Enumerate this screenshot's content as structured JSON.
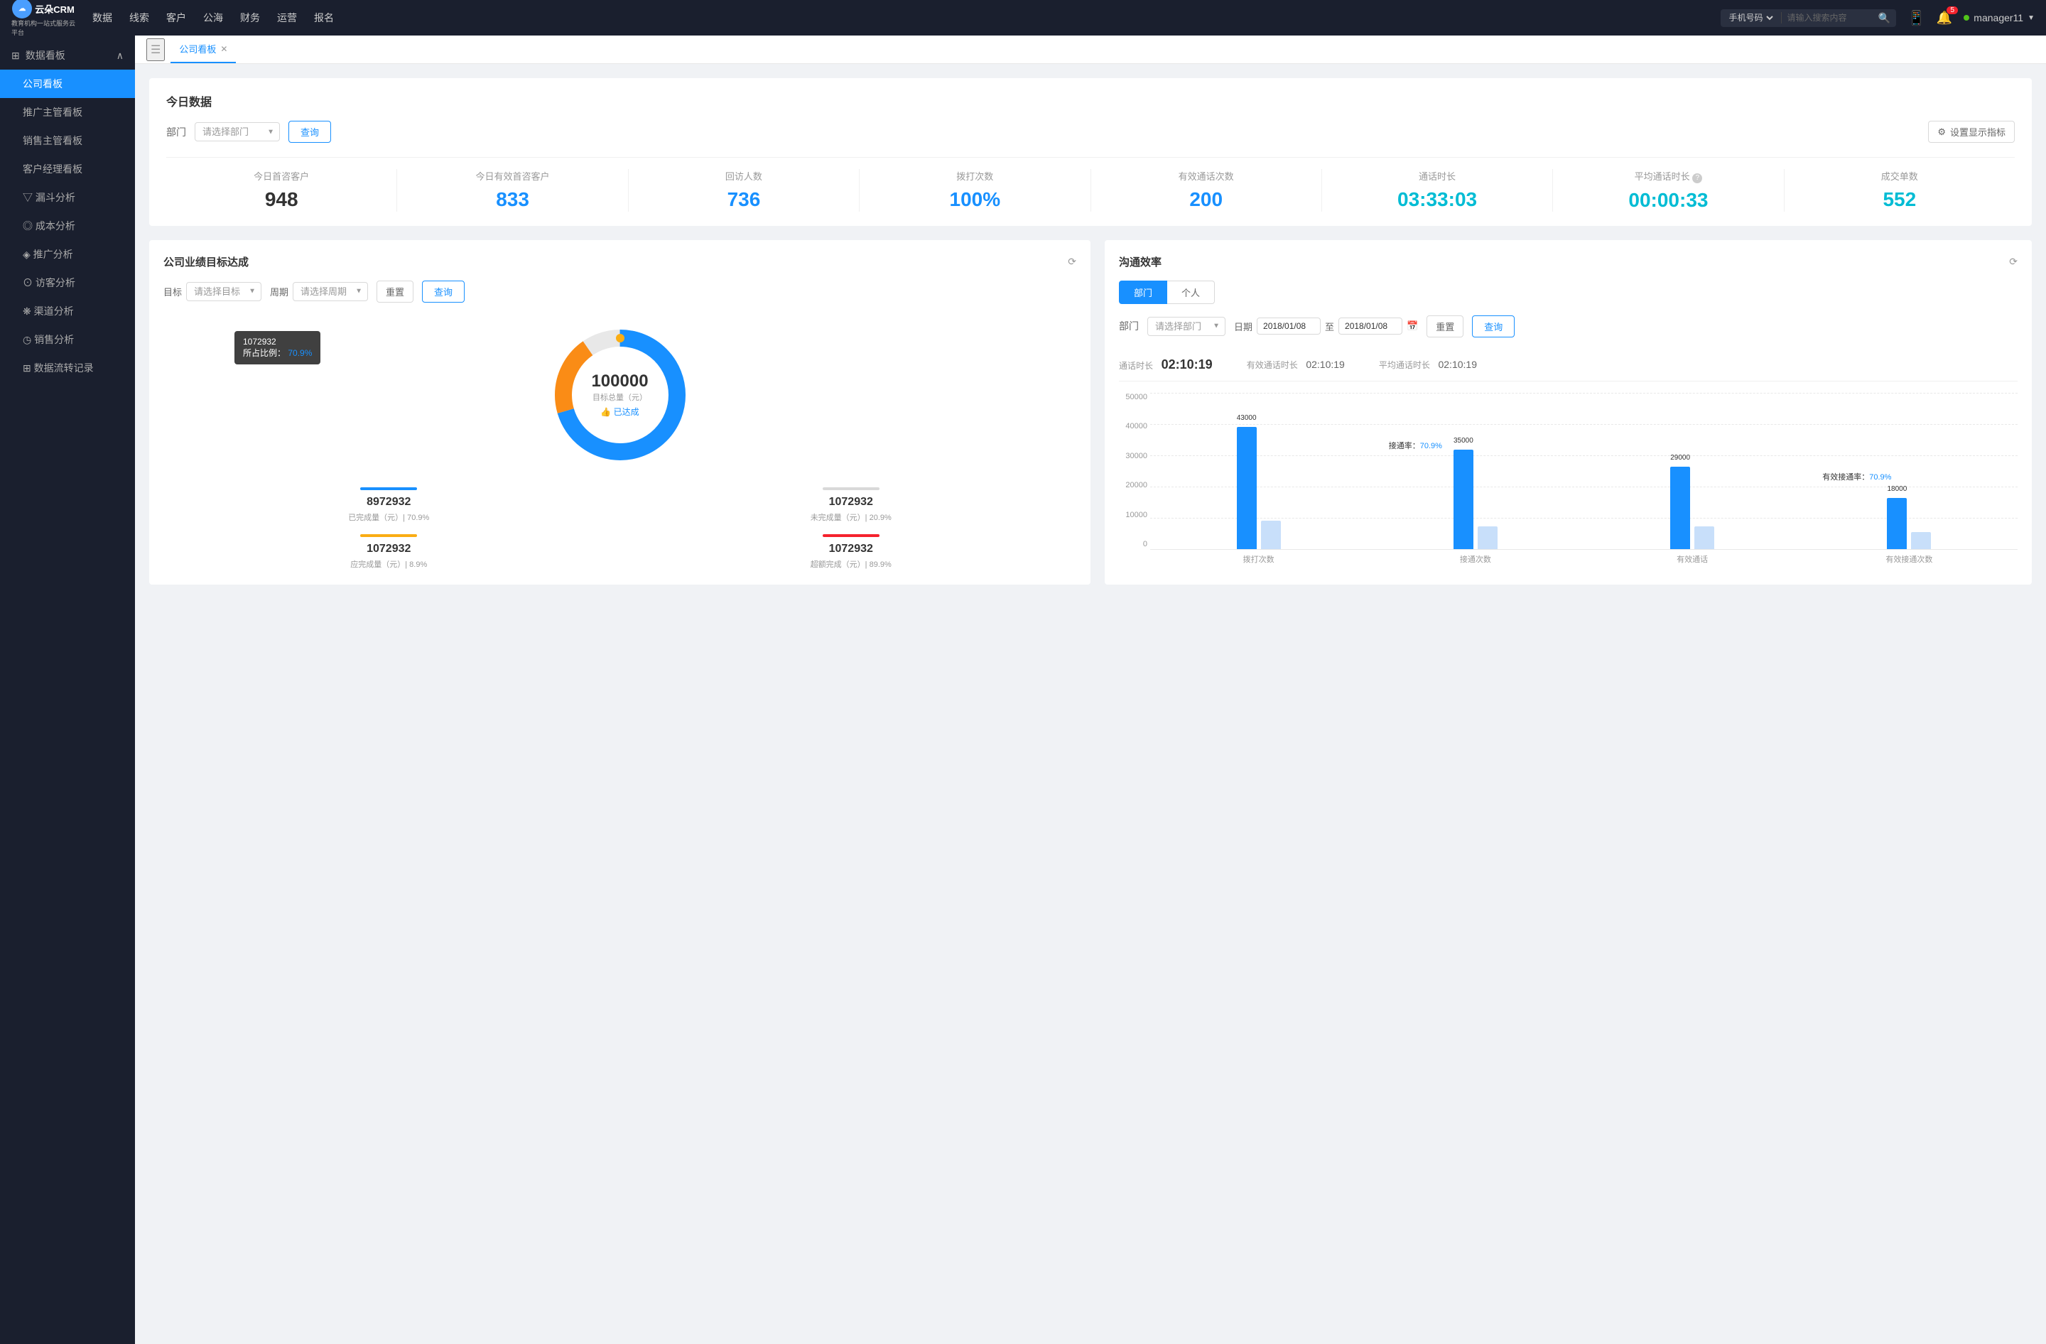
{
  "topNav": {
    "logoText": "云朵CRM",
    "logoSub": "教育机构一站式服务云平台",
    "navItems": [
      "数据",
      "线索",
      "客户",
      "公海",
      "财务",
      "运营",
      "报名"
    ],
    "searchPlaceholder": "请输入搜索内容",
    "searchSelect": "手机号码",
    "notificationCount": "5",
    "userName": "manager11"
  },
  "sidebar": {
    "sectionTitle": "数据看板",
    "items": [
      {
        "label": "公司看板",
        "active": true
      },
      {
        "label": "推广主管看板",
        "active": false
      },
      {
        "label": "销售主管看板",
        "active": false
      },
      {
        "label": "客户经理看板",
        "active": false
      },
      {
        "label": "漏斗分析",
        "active": false
      },
      {
        "label": "成本分析",
        "active": false
      },
      {
        "label": "推广分析",
        "active": false
      },
      {
        "label": "访客分析",
        "active": false
      },
      {
        "label": "渠道分析",
        "active": false
      },
      {
        "label": "销售分析",
        "active": false
      },
      {
        "label": "数据流转记录",
        "active": false
      }
    ]
  },
  "tabs": {
    "activeTab": "公司看板"
  },
  "todayData": {
    "sectionTitle": "今日数据",
    "filterLabel": "部门",
    "filterPlaceholder": "请选择部门",
    "queryBtnLabel": "查询",
    "settingsBtnLabel": "设置显示指标",
    "metrics": [
      {
        "label": "今日首咨客户",
        "value": "948",
        "colorClass": "black"
      },
      {
        "label": "今日有效首咨客户",
        "value": "833",
        "colorClass": "blue"
      },
      {
        "label": "回访人数",
        "value": "736",
        "colorClass": "blue"
      },
      {
        "label": "拨打次数",
        "value": "100%",
        "colorClass": "blue"
      },
      {
        "label": "有效通话次数",
        "value": "200",
        "colorClass": "blue"
      },
      {
        "label": "通话时长",
        "value": "03:33:03",
        "colorClass": "cyan"
      },
      {
        "label": "平均通话时长",
        "value": "00:00:33",
        "colorClass": "cyan"
      },
      {
        "label": "成交单数",
        "value": "552",
        "colorClass": "cyan"
      }
    ]
  },
  "goalPanel": {
    "title": "公司业绩目标达成",
    "goalLabel": "目标",
    "goalPlaceholder": "请选择目标",
    "periodLabel": "周期",
    "periodPlaceholder": "请选择周期",
    "resetLabel": "重置",
    "queryLabel": "查询",
    "tooltip": {
      "value": "1072932",
      "ratio": "70.9%",
      "ratioLabel": "所占比例："
    },
    "donut": {
      "centerValue": "100000",
      "centerLabel": "目标总量（元）",
      "centerStatus": "👍 已达成",
      "achieved": 70.9
    },
    "stats": [
      {
        "label": "已完成量（元）| 70.9%",
        "value": "8972932",
        "color": "#1890ff",
        "barColor": "#1890ff"
      },
      {
        "label": "未完成量（元）| 20.9%",
        "value": "1072932",
        "color": "#333",
        "barColor": "#d9d9d9"
      },
      {
        "label": "应完成量（元）| 8.9%",
        "value": "1072932",
        "color": "#333",
        "barColor": "#faad14"
      },
      {
        "label": "超额完成（元）| 89.9%",
        "value": "1072932",
        "color": "#333",
        "barColor": "#f5222d"
      }
    ]
  },
  "commPanel": {
    "title": "沟通效率",
    "tabs": [
      "部门",
      "个人"
    ],
    "activeTab": "部门",
    "deptLabel": "部门",
    "deptPlaceholder": "请选择部门",
    "dateLabel": "日期",
    "dateFrom": "2018/01/08",
    "dateTo": "2018/01/08",
    "resetLabel": "重置",
    "queryLabel": "查询",
    "stats": {
      "talkTime": {
        "label": "通话时长",
        "value": "02:10:19"
      },
      "effectiveTalkTime": {
        "label": "有效通话时长",
        "value": "02:10:19"
      },
      "avgTalkTime": {
        "label": "平均通话时长",
        "value": "02:10:19"
      }
    },
    "chart": {
      "yLabels": [
        "50000",
        "40000",
        "30000",
        "20000",
        "10000",
        "0"
      ],
      "groups": [
        {
          "xLabel": "拨打次数",
          "bars": [
            {
              "value": 43000,
              "height": 172,
              "color": "#1890ff",
              "label": "43000"
            },
            {
              "value": 10000,
              "height": 40,
              "color": "#d9d9d9",
              "label": ""
            }
          ],
          "annotation": null
        },
        {
          "xLabel": "接通次数",
          "bars": [
            {
              "value": 35000,
              "height": 140,
              "color": "#1890ff",
              "label": "35000"
            },
            {
              "value": 8000,
              "height": 32,
              "color": "#d9d9d9",
              "label": ""
            }
          ],
          "annotation": "接通率：70.9%"
        },
        {
          "xLabel": "有效通话",
          "bars": [
            {
              "value": 29000,
              "height": 116,
              "color": "#1890ff",
              "label": "29000"
            },
            {
              "value": 8000,
              "height": 32,
              "color": "#d9d9d9",
              "label": ""
            }
          ],
          "annotation": null
        },
        {
          "xLabel": "有效接通次数",
          "bars": [
            {
              "value": 18000,
              "height": 72,
              "color": "#1890ff",
              "label": "18000"
            },
            {
              "value": 6000,
              "height": 24,
              "color": "#d9d9d9",
              "label": ""
            }
          ],
          "annotation": "有效接通率：70.9%"
        }
      ]
    }
  }
}
